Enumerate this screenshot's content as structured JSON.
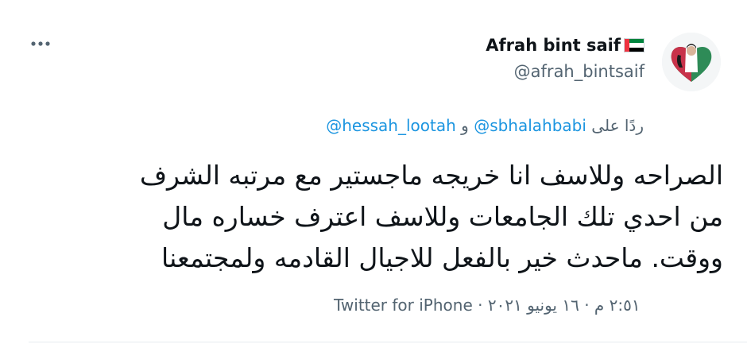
{
  "author": {
    "display_name": "Afrah bint saif",
    "handle": "@afrah_bintsaif",
    "flag_icon": "uae-flag-icon"
  },
  "reply": {
    "prefix": "ردًا على",
    "mention_1": "@sbhalahbabi",
    "conjunction": "و",
    "mention_2": "@hessah_lootah"
  },
  "tweet": {
    "lines": [
      "الصراحه وللاسف انا خريجه ماجستير مع مرتبه الشرف",
      "من احدي تلك الجامعات وللاسف اعترف خساره مال",
      "ووقت. ماحدث خير بالفعل للاجيال القادمه ولمجتمعنا"
    ]
  },
  "meta": {
    "datetime": "٢:٥١ م · ١٦ يونيو ٢٠٢١",
    "separator": "·",
    "source": "Twitter for iPhone"
  },
  "colors": {
    "text_primary": "#0f1419",
    "text_secondary": "#536471",
    "link": "#1b95e0",
    "divider": "#e6ecf0"
  },
  "icons": {
    "more": "more-horizontal-icon",
    "avatar": "heart-avatar"
  }
}
